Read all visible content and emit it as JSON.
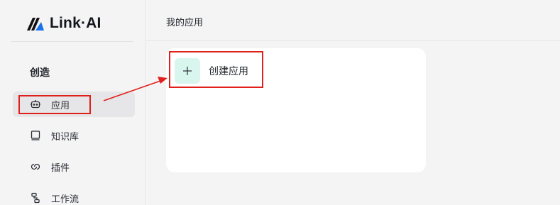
{
  "brand": {
    "name": "Link·AI",
    "accent": "#1a73e8"
  },
  "sidebar": {
    "section_title": "创造",
    "items": [
      {
        "label": "应用",
        "icon": "robot-icon",
        "active": true
      },
      {
        "label": "知识库",
        "icon": "book-icon",
        "active": false
      },
      {
        "label": "插件",
        "icon": "plugin-link-icon",
        "active": false
      },
      {
        "label": "工作流",
        "icon": "workflow-icon",
        "active": false
      }
    ]
  },
  "main": {
    "title": "我的应用",
    "create_button_label": "创建应用"
  },
  "colors": {
    "highlight": "#e0201b",
    "plus_tile": "#d8f6ee"
  }
}
